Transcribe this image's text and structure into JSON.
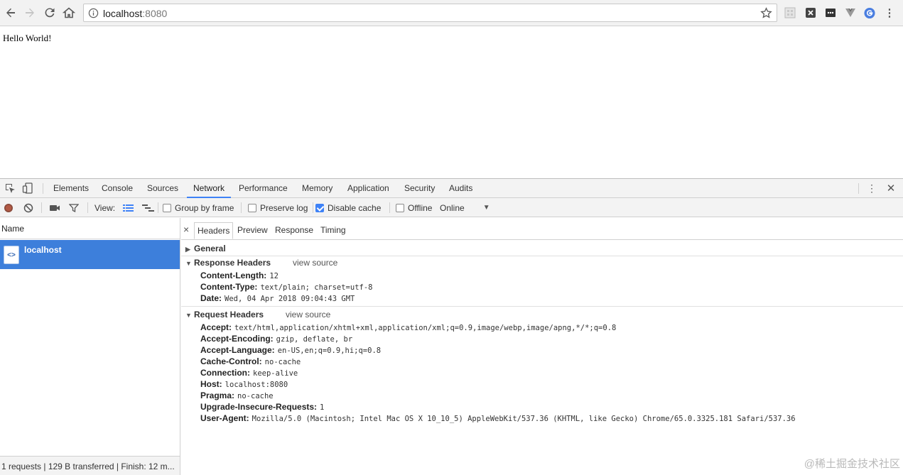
{
  "browser": {
    "url_host": "localhost",
    "url_port": ":8080"
  },
  "page": {
    "text": "Hello World!"
  },
  "devtools": {
    "tabs": [
      "Elements",
      "Console",
      "Sources",
      "Network",
      "Performance",
      "Memory",
      "Application",
      "Security",
      "Audits"
    ],
    "active_tab": "Network",
    "toolbar": {
      "view_label": "View:",
      "group_by_frame": "Group by frame",
      "preserve_log": "Preserve log",
      "disable_cache": "Disable cache",
      "offline": "Offline",
      "throttling": "Online",
      "disable_cache_checked": true,
      "preserve_log_checked": false,
      "group_by_frame_checked": false,
      "offline_checked": false
    },
    "requests": {
      "column_name": "Name",
      "items": [
        {
          "name": "localhost"
        }
      ],
      "status": "1 requests | 129 B transferred | Finish: 12 m..."
    },
    "detail": {
      "close": "×",
      "tabs": [
        "Headers",
        "Preview",
        "Response",
        "Timing"
      ],
      "active_tab": "Headers",
      "general": {
        "title": "General"
      },
      "response_headers": {
        "title": "Response Headers",
        "view_source": "view source",
        "items": [
          {
            "key": "Content-Length:",
            "value": "12"
          },
          {
            "key": "Content-Type:",
            "value": "text/plain; charset=utf-8"
          },
          {
            "key": "Date:",
            "value": "Wed, 04 Apr 2018 09:04:43 GMT"
          }
        ]
      },
      "request_headers": {
        "title": "Request Headers",
        "view_source": "view source",
        "items": [
          {
            "key": "Accept:",
            "value": "text/html,application/xhtml+xml,application/xml;q=0.9,image/webp,image/apng,*/*;q=0.8"
          },
          {
            "key": "Accept-Encoding:",
            "value": "gzip, deflate, br"
          },
          {
            "key": "Accept-Language:",
            "value": "en-US,en;q=0.9,hi;q=0.8"
          },
          {
            "key": "Cache-Control:",
            "value": "no-cache"
          },
          {
            "key": "Connection:",
            "value": "keep-alive"
          },
          {
            "key": "Host:",
            "value": "localhost:8080"
          },
          {
            "key": "Pragma:",
            "value": "no-cache"
          },
          {
            "key": "Upgrade-Insecure-Requests:",
            "value": "1"
          },
          {
            "key": "User-Agent:",
            "value": "Mozilla/5.0 (Macintosh; Intel Mac OS X 10_10_5) AppleWebKit/537.36 (KHTML, like Gecko) Chrome/65.0.3325.181 Safari/537.36"
          }
        ]
      }
    }
  },
  "watermark": "@稀土掘金技术社区",
  "colors": {
    "accent": "#3e82f7",
    "selected_row": "#3d7fdb"
  }
}
